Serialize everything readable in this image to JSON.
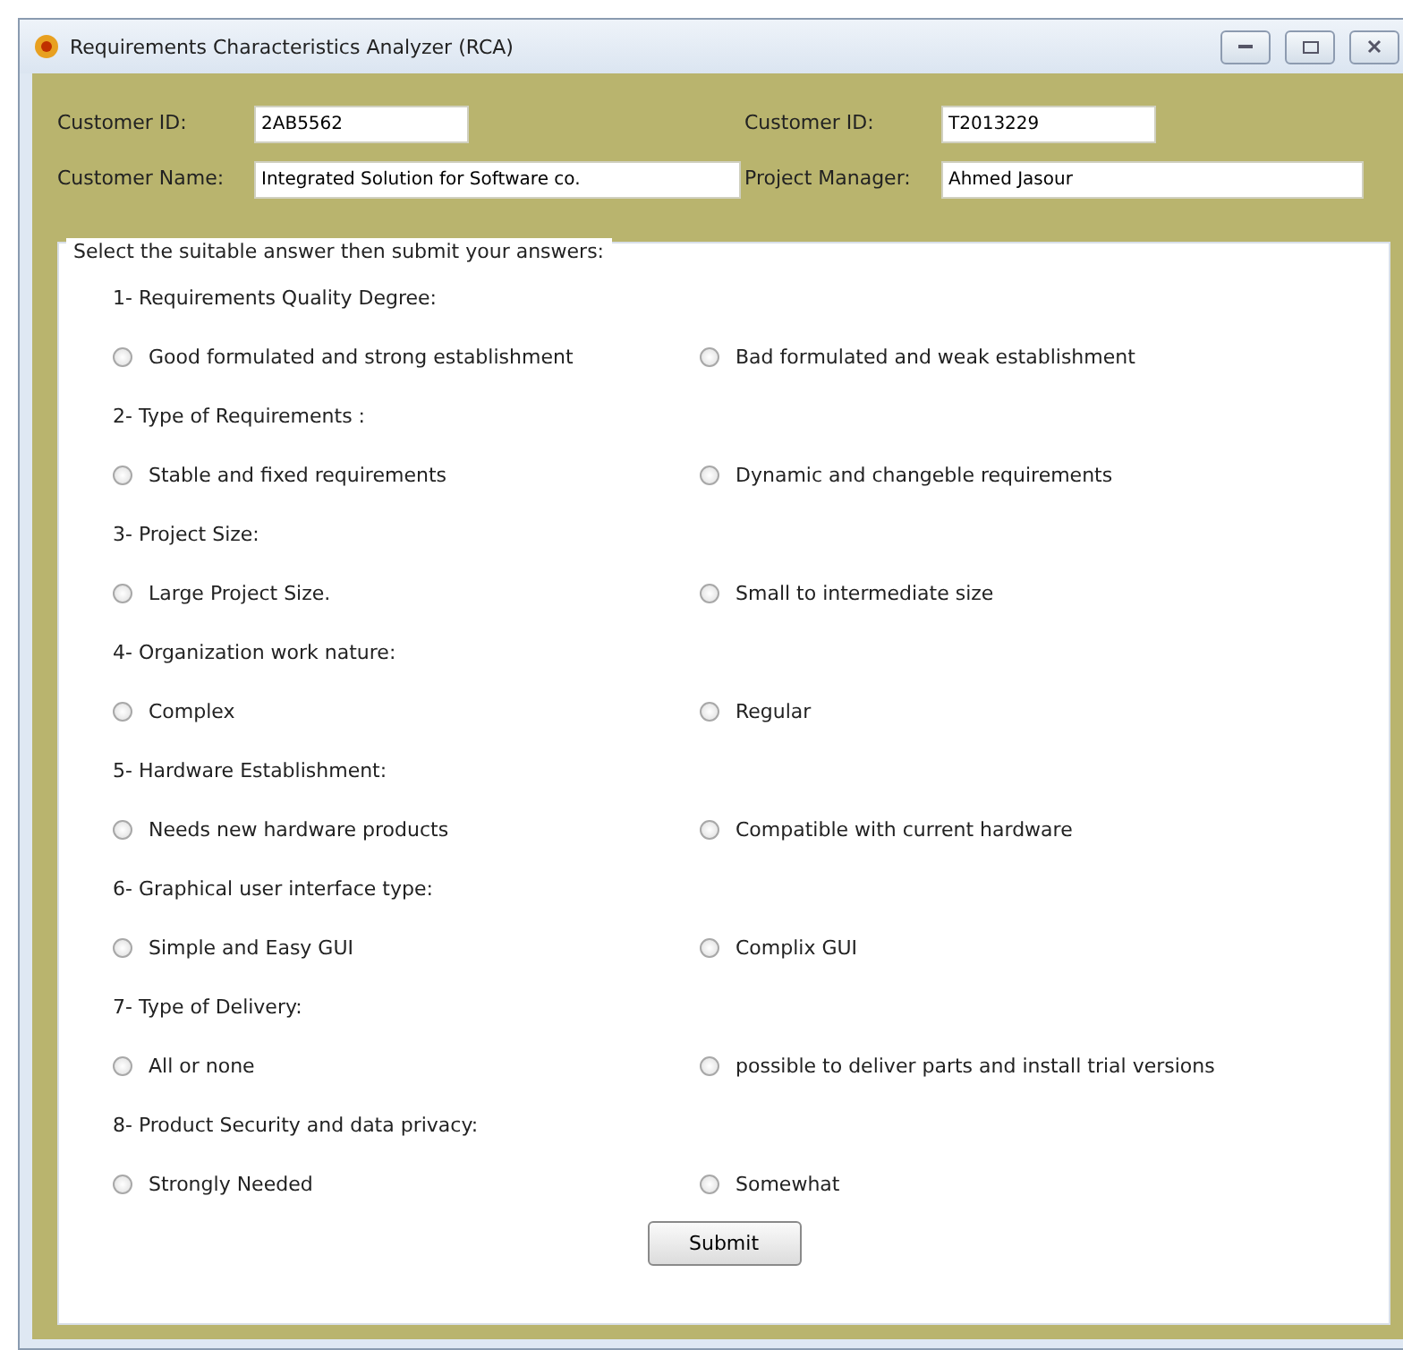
{
  "window": {
    "title": "Requirements Characteristics Analyzer (RCA)"
  },
  "fields": [
    {
      "label": "Customer ID:",
      "value": "2AB5562"
    },
    {
      "label": "Customer ID:",
      "value": "T2013229"
    },
    {
      "label": "Customer Name:",
      "value": "Integrated Solution for Software co."
    },
    {
      "label": "Project Manager:",
      "value": "Ahmed Jasour"
    }
  ],
  "form": {
    "legend": "Select the suitable answer then submit your answers:",
    "questions": [
      {
        "label": "1- Requirements Quality Degree:",
        "options": [
          {
            "label": "Good formulated and strong establishment",
            "selected": false
          },
          {
            "label": "Bad formulated and weak establishment",
            "selected": false
          }
        ]
      },
      {
        "label": "2- Type of Requirements :",
        "options": [
          {
            "label": "Stable and fixed requirements",
            "selected": false
          },
          {
            "label": "Dynamic and changeble requirements",
            "selected": false
          }
        ]
      },
      {
        "label": "3- Project Size:",
        "options": [
          {
            "label": "Large Project Size.",
            "selected": false
          },
          {
            "label": "Small to intermediate size",
            "selected": false
          }
        ]
      },
      {
        "label": "4- Organization work nature:",
        "options": [
          {
            "label": "Complex",
            "selected": false
          },
          {
            "label": "Regular",
            "selected": false
          }
        ]
      },
      {
        "label": "5- Hardware Establishment:",
        "options": [
          {
            "label": "Needs new hardware products",
            "selected": false
          },
          {
            "label": "Compatible with current hardware",
            "selected": false
          }
        ]
      },
      {
        "label": "6- Graphical user interface type:",
        "options": [
          {
            "label": "Simple and Easy GUI",
            "selected": false
          },
          {
            "label": "Complix GUI",
            "selected": false
          }
        ]
      },
      {
        "label": "7- Type of Delivery:",
        "options": [
          {
            "label": "All or none",
            "selected": false
          },
          {
            "label": "possible to deliver parts and install trial versions",
            "selected": false
          }
        ]
      },
      {
        "label": "8- Product Security and data privacy:",
        "options": [
          {
            "label": "Strongly Needed",
            "selected": false
          },
          {
            "label": "Somewhat",
            "selected": false
          }
        ]
      }
    ],
    "submit": "Submit"
  }
}
